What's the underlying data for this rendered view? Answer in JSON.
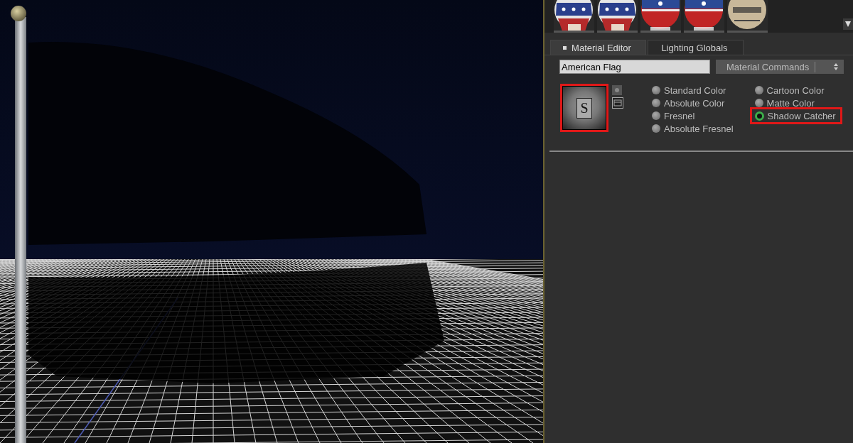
{
  "viewport": {
    "kind": "render"
  },
  "material_library": {
    "thumbnails": [
      {
        "kind": "stars",
        "selected": false
      },
      {
        "kind": "stars",
        "selected": false
      },
      {
        "kind": "stripes",
        "selected": false
      },
      {
        "kind": "stripes",
        "selected": false
      },
      {
        "kind": "metal",
        "selected": false
      }
    ]
  },
  "tabs": [
    {
      "label": "Material Editor",
      "selected": true
    },
    {
      "label": "Lighting Globals",
      "selected": false
    }
  ],
  "material_name": {
    "value": "American Flag"
  },
  "commands_dropdown": {
    "label": "Material Commands"
  },
  "preview": {
    "letter": "S",
    "highlighted": true
  },
  "shader_types": [
    [
      {
        "label": "Standard Color",
        "selected": false,
        "highlighted": false
      },
      {
        "label": "Absolute Color",
        "selected": false,
        "highlighted": false
      },
      {
        "label": "Fresnel",
        "selected": false,
        "highlighted": false
      },
      {
        "label": "Absolute Fresnel",
        "selected": false,
        "highlighted": false
      }
    ],
    [
      {
        "label": "Cartoon Color",
        "selected": false,
        "highlighted": false
      },
      {
        "label": "Matte Color",
        "selected": false,
        "highlighted": false
      },
      {
        "label": "Shadow Catcher",
        "selected": true,
        "highlighted": true
      }
    ]
  ]
}
